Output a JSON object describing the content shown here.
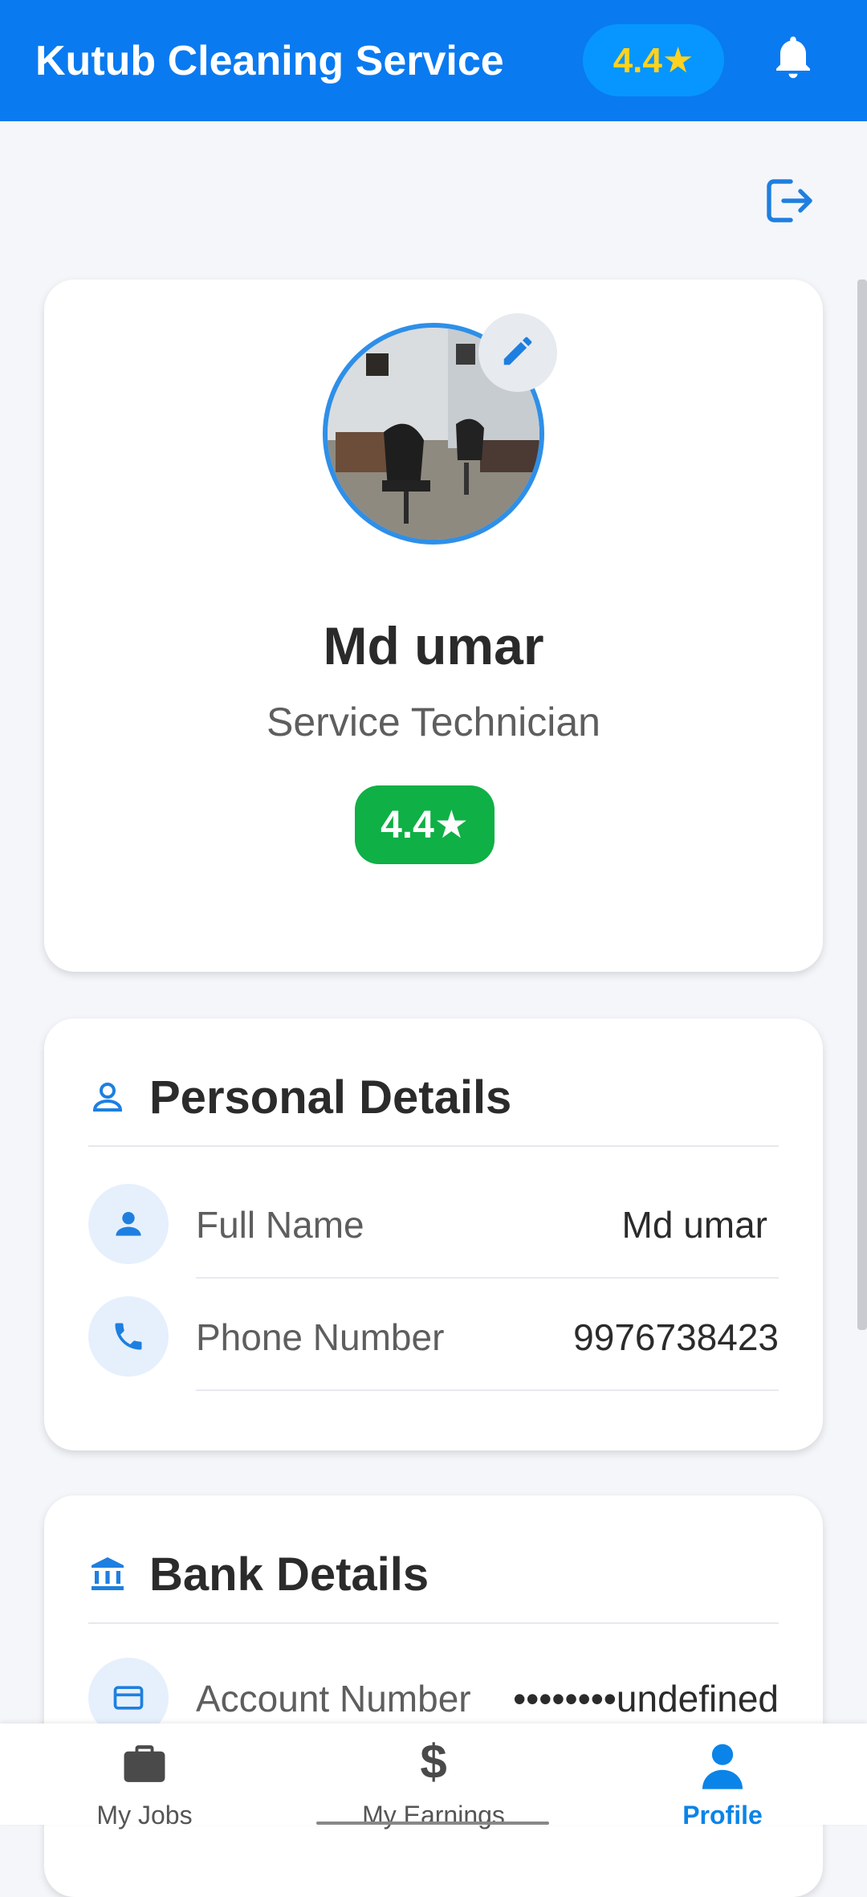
{
  "header": {
    "title": "Kutub Cleaning Service",
    "rating": "4.4★"
  },
  "profile": {
    "name": "Md umar",
    "role": "Service Technician",
    "rating": "4.4★"
  },
  "personal": {
    "title": "Personal Details",
    "rows": [
      {
        "label": "Full Name",
        "value": "Md umar"
      },
      {
        "label": "Phone Number",
        "value": "9976738423"
      }
    ]
  },
  "bank": {
    "title": "Bank Details",
    "rows": [
      {
        "label": "Account Number",
        "value": "••••••••undefined"
      }
    ]
  },
  "nav": {
    "items": [
      {
        "label": "My Jobs",
        "icon": "briefcase-icon"
      },
      {
        "label": "My Earnings",
        "icon": "dollar-icon"
      },
      {
        "label": "Profile",
        "icon": "person-icon",
        "active": true
      }
    ]
  },
  "colors": {
    "primary": "#0A7AF0",
    "rating_green": "#0FB045",
    "header_star": "#FFD21F"
  }
}
